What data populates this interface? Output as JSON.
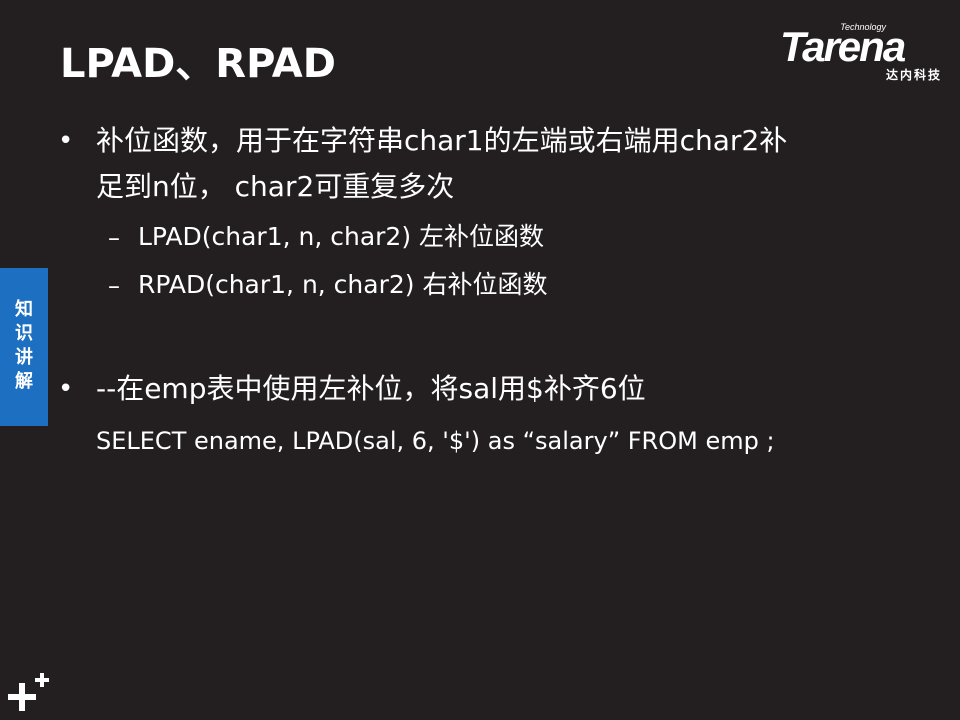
{
  "title": "LPAD、RPAD",
  "logo": {
    "brand": "Tarena",
    "technology": "Technology",
    "chinese": "达内科技"
  },
  "side_tab": {
    "label": "知识讲解"
  },
  "bullets": [
    {
      "marker": "•",
      "line1": "补位函数，用于在字符串char1的左端或右端用char2补",
      "line2": "足到n位， char2可重复多次",
      "sub": [
        {
          "marker": "–",
          "text": "LPAD(char1, n, char2)  左补位函数"
        },
        {
          "marker": "–",
          "text": "RPAD(char1, n, char2)  右补位函数"
        }
      ]
    },
    {
      "marker": "•",
      "line1": "--在emp表中使用左补位，将sal用$补齐6位",
      "code": "SELECT ename, LPAD(sal, 6, '$') as  “salary”  FROM emp ;"
    }
  ],
  "colors": {
    "background": "#231f20",
    "text": "#ffffff",
    "side_tab": "#1d6fc2"
  },
  "icons": {
    "corner": "plus-plus-icon"
  }
}
